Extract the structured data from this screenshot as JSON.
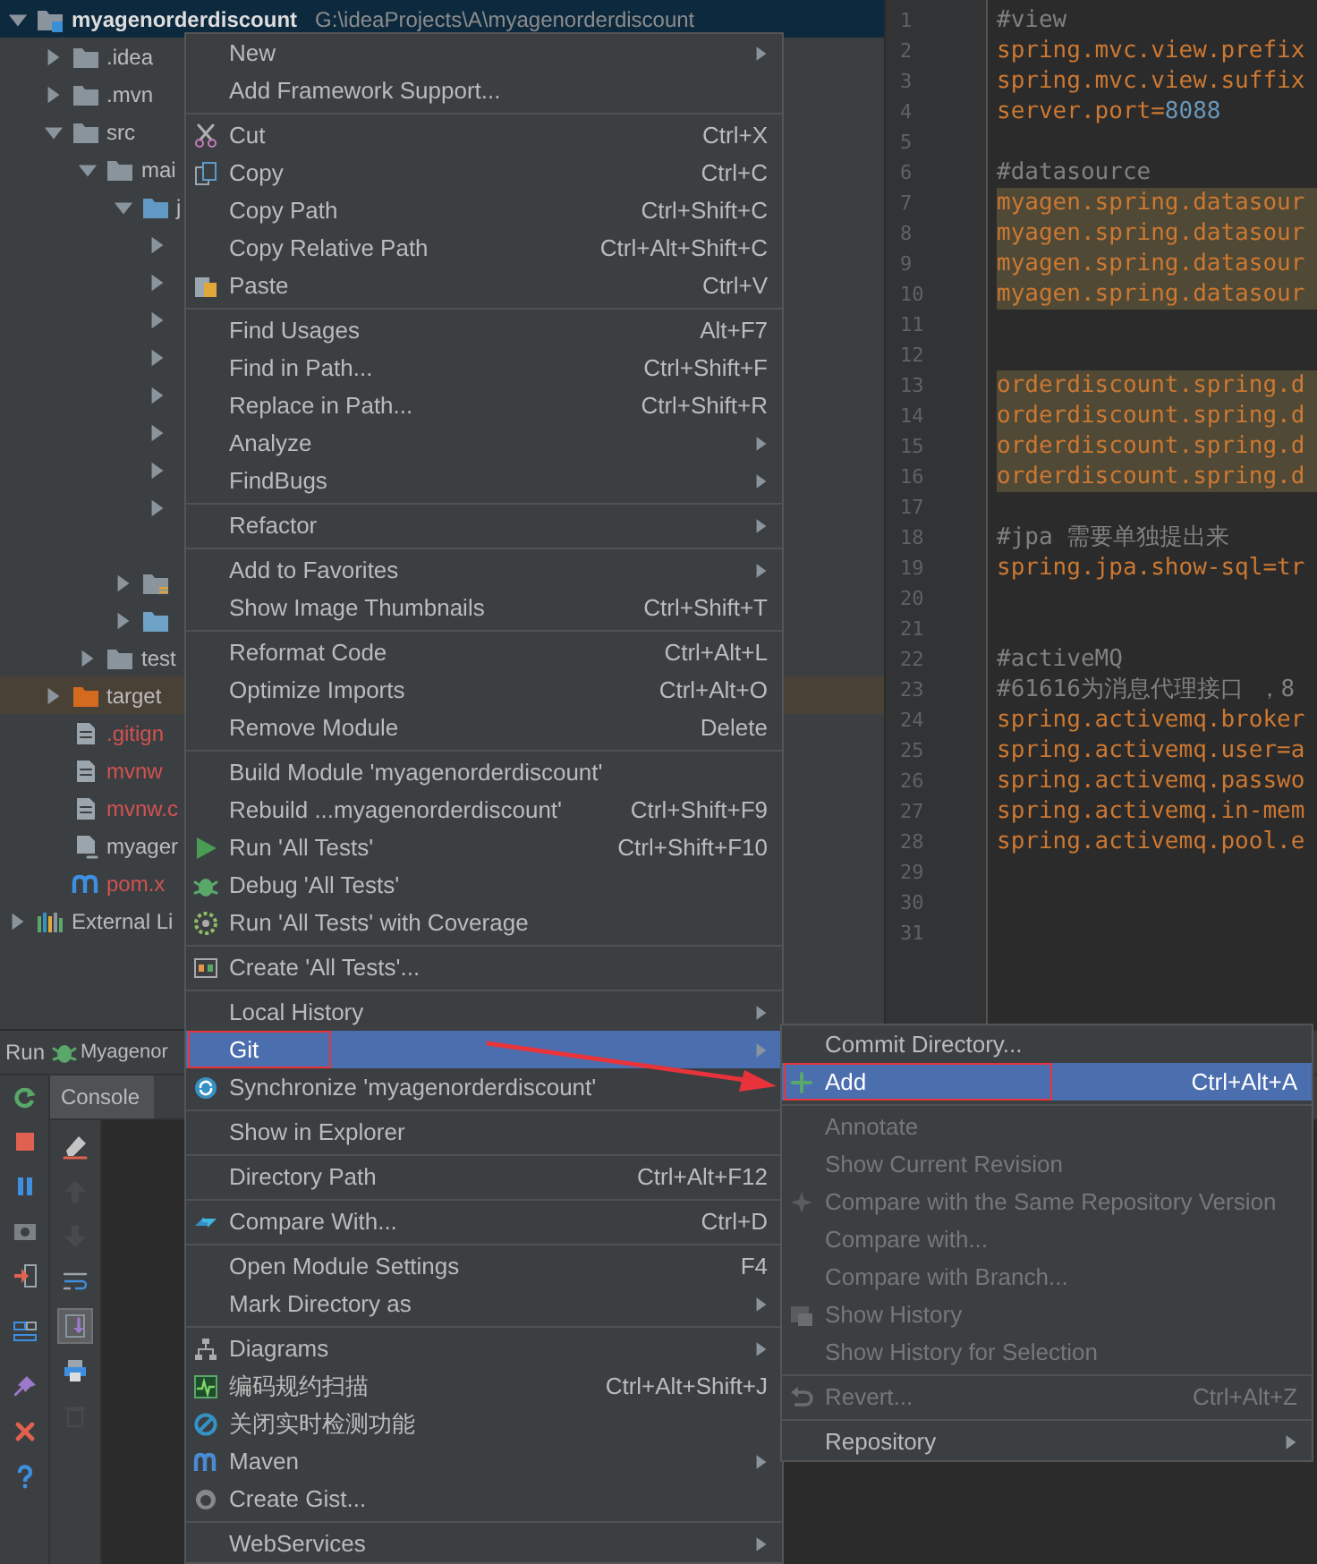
{
  "project_tree": [
    {
      "label": "myagenorderdiscount",
      "path": "G:\\ideaProjects\\A\\myagenorderdiscount",
      "kind": "module",
      "expanded": true,
      "selected": true,
      "untracked": false,
      "children": [
        {
          "label": ".idea",
          "kind": "folder",
          "expanded": false,
          "selected": false,
          "untracked": false
        },
        {
          "label": ".mvn",
          "kind": "folder",
          "expanded": false,
          "selected": false,
          "untracked": false
        },
        {
          "label": "src",
          "kind": "folder",
          "expanded": true,
          "selected": false,
          "untracked": false,
          "children": [
            {
              "label": "mai",
              "kind": "folder",
              "expanded": true,
              "selected": false,
              "untracked": false,
              "children": [
                {
                  "label": "j",
                  "kind": "source-folder",
                  "expanded": true,
                  "selected": false,
                  "untracked": false,
                  "children": [
                    {
                      "expanded": false,
                      "selected": false
                    },
                    {
                      "expanded": false,
                      "selected": false
                    },
                    {
                      "expanded": false,
                      "selected": false
                    },
                    {
                      "expanded": false,
                      "selected": false
                    },
                    {
                      "expanded": false,
                      "selected": false
                    },
                    {
                      "expanded": false,
                      "selected": false
                    },
                    {
                      "expanded": false,
                      "selected": false
                    },
                    {
                      "expanded": false,
                      "selected": false
                    },
                    {
                      "selected": false
                    }
                  ]
                },
                {
                  "kind": "resources-folder",
                  "expanded": false,
                  "selected": false
                },
                {
                  "kind": "web-folder",
                  "expanded": false,
                  "selected": false
                }
              ]
            },
            {
              "label": "test",
              "kind": "folder",
              "expanded": false,
              "selected": false,
              "untracked": false
            }
          ]
        },
        {
          "label": "target",
          "kind": "excluded-folder",
          "expanded": false,
          "selected": false,
          "untracked": false
        },
        {
          "label": ".gitign",
          "kind": "file",
          "selected": false,
          "untracked": true
        },
        {
          "label": "mvnw",
          "kind": "file",
          "selected": false,
          "untracked": true
        },
        {
          "label": "mvnw.c",
          "kind": "file",
          "selected": false,
          "untracked": true
        },
        {
          "label": "myager",
          "kind": "module-file",
          "selected": false,
          "untracked": false
        },
        {
          "label": "pom.x",
          "kind": "maven-file",
          "selected": false,
          "untracked": true
        }
      ]
    },
    {
      "label": "External Li",
      "kind": "library",
      "expanded": false,
      "selected": false,
      "untracked": false
    }
  ],
  "editor": {
    "lines": [
      {
        "n": "1",
        "kind": "comment",
        "text": "#view",
        "highlighted": false
      },
      {
        "n": "2",
        "kind": "property",
        "text": "spring.mvc.view.prefix",
        "highlighted": false
      },
      {
        "n": "3",
        "kind": "property",
        "text": "spring.mvc.view.suffix",
        "highlighted": false
      },
      {
        "n": "4",
        "kind": "property",
        "text": "server.port=",
        "value": "8088",
        "highlighted": false
      },
      {
        "n": "5",
        "kind": "blank",
        "highlighted": false
      },
      {
        "n": "6",
        "kind": "comment",
        "text": "#datasource",
        "highlighted": false
      },
      {
        "n": "7",
        "kind": "property",
        "text": "myagen.spring.datasour",
        "highlighted": true
      },
      {
        "n": "8",
        "kind": "property",
        "text": "myagen.spring.datasour",
        "highlighted": true
      },
      {
        "n": "9",
        "kind": "property",
        "text": "myagen.spring.datasour",
        "highlighted": true
      },
      {
        "n": "10",
        "kind": "property",
        "text": "myagen.spring.datasour",
        "highlighted": true
      },
      {
        "n": "11",
        "kind": "blank",
        "highlighted": false
      },
      {
        "n": "12",
        "kind": "blank",
        "highlighted": false
      },
      {
        "n": "13",
        "kind": "property",
        "text": "orderdiscount.spring.d",
        "highlighted": true
      },
      {
        "n": "14",
        "kind": "property",
        "text": "orderdiscount.spring.d",
        "highlighted": true
      },
      {
        "n": "15",
        "kind": "property",
        "text": "orderdiscount.spring.d",
        "highlighted": true
      },
      {
        "n": "16",
        "kind": "property",
        "text": "orderdiscount.spring.d",
        "highlighted": true
      },
      {
        "n": "17",
        "kind": "blank",
        "highlighted": false
      },
      {
        "n": "18",
        "kind": "comment",
        "text": "#jpa 需要单独提出来",
        "highlighted": false
      },
      {
        "n": "19",
        "kind": "property",
        "text": "spring.jpa.show-sql=tr",
        "highlighted": false
      },
      {
        "n": "20",
        "kind": "blank",
        "highlighted": false
      },
      {
        "n": "21",
        "kind": "blank",
        "highlighted": false
      },
      {
        "n": "22",
        "kind": "comment",
        "text": "#activeMQ",
        "highlighted": false
      },
      {
        "n": "23",
        "kind": "comment",
        "text": "#61616为消息代理接口 ，8",
        "highlighted": false
      },
      {
        "n": "24",
        "kind": "property",
        "text": "spring.activemq.broker",
        "highlighted": false
      },
      {
        "n": "25",
        "kind": "property",
        "text": "spring.activemq.user=a",
        "highlighted": false
      },
      {
        "n": "26",
        "kind": "property",
        "text": "spring.activemq.passwo",
        "highlighted": false
      },
      {
        "n": "27",
        "kind": "property",
        "text": "spring.activemq.in-mem",
        "highlighted": false
      },
      {
        "n": "28",
        "kind": "property",
        "text": "spring.activemq.pool.e",
        "highlighted": false
      },
      {
        "n": "29",
        "kind": "blank",
        "highlighted": false
      },
      {
        "n": "30",
        "kind": "blank",
        "highlighted": false
      },
      {
        "n": "31",
        "kind": "blank",
        "highlighted": false
      }
    ]
  },
  "run_panel": {
    "title": "Run",
    "config": "Myagenor",
    "tab": {
      "label": "Console",
      "selected": true
    },
    "console_tools": [
      {
        "disabled": false,
        "selected": false
      },
      {
        "disabled": true,
        "selected": false
      },
      {
        "disabled": true,
        "selected": false
      },
      {
        "disabled": false,
        "selected": false
      },
      {
        "disabled": false,
        "selected": true
      },
      {
        "disabled": false,
        "selected": false
      },
      {
        "disabled": true,
        "selected": false
      }
    ]
  },
  "context_menu": {
    "sections": [
      [
        {
          "label": "New",
          "has_submenu": true,
          "selected": false,
          "marked": false
        },
        {
          "label": "Add Framework Support...",
          "has_submenu": false,
          "selected": false,
          "marked": false
        }
      ],
      [
        {
          "label": "Cut",
          "shortcut": "Ctrl+X",
          "has_submenu": false,
          "selected": false,
          "marked": false
        },
        {
          "label": "Copy",
          "shortcut": "Ctrl+C",
          "has_submenu": false,
          "selected": false,
          "marked": false
        },
        {
          "label": "Copy Path",
          "shortcut": "Ctrl+Shift+C",
          "has_submenu": false,
          "selected": false,
          "marked": false
        },
        {
          "label": "Copy Relative Path",
          "shortcut": "Ctrl+Alt+Shift+C",
          "has_submenu": false,
          "selected": false,
          "marked": false
        },
        {
          "label": "Paste",
          "shortcut": "Ctrl+V",
          "has_submenu": false,
          "selected": false,
          "marked": false
        }
      ],
      [
        {
          "label": "Find Usages",
          "shortcut": "Alt+F7",
          "has_submenu": false,
          "selected": false,
          "marked": false
        },
        {
          "label": "Find in Path...",
          "shortcut": "Ctrl+Shift+F",
          "has_submenu": false,
          "selected": false,
          "marked": false
        },
        {
          "label": "Replace in Path...",
          "shortcut": "Ctrl+Shift+R",
          "has_submenu": false,
          "selected": false,
          "marked": false
        },
        {
          "label": "Analyze",
          "has_submenu": true,
          "selected": false,
          "marked": false
        },
        {
          "label": "FindBugs",
          "has_submenu": true,
          "selected": false,
          "marked": false
        }
      ],
      [
        {
          "label": "Refactor",
          "has_submenu": true,
          "selected": false,
          "marked": false
        }
      ],
      [
        {
          "label": "Add to Favorites",
          "has_submenu": true,
          "selected": false,
          "marked": false
        },
        {
          "label": "Show Image Thumbnails",
          "shortcut": "Ctrl+Shift+T",
          "has_submenu": false,
          "selected": false,
          "marked": false
        }
      ],
      [
        {
          "label": "Reformat Code",
          "shortcut": "Ctrl+Alt+L",
          "has_submenu": false,
          "selected": false,
          "marked": false
        },
        {
          "label": "Optimize Imports",
          "shortcut": "Ctrl+Alt+O",
          "has_submenu": false,
          "selected": false,
          "marked": false
        },
        {
          "label": "Remove Module",
          "shortcut": "Delete",
          "has_submenu": false,
          "selected": false,
          "marked": false
        }
      ],
      [
        {
          "label": "Build Module 'myagenorderdiscount'",
          "has_submenu": false,
          "selected": false,
          "marked": false
        },
        {
          "label": "Rebuild ...myagenorderdiscount'",
          "shortcut": "Ctrl+Shift+F9",
          "has_submenu": false,
          "selected": false,
          "marked": false
        },
        {
          "label": "Run 'All Tests'",
          "shortcut": "Ctrl+Shift+F10",
          "has_submenu": false,
          "selected": false,
          "marked": false
        },
        {
          "label": "Debug 'All Tests'",
          "has_submenu": false,
          "selected": false,
          "marked": false
        },
        {
          "label": "Run 'All Tests' with Coverage",
          "has_submenu": false,
          "selected": false,
          "marked": false
        }
      ],
      [
        {
          "label": "Create 'All Tests'...",
          "has_submenu": false,
          "selected": false,
          "marked": false
        }
      ],
      [
        {
          "label": "Local History",
          "has_submenu": true,
          "selected": false,
          "marked": false
        },
        {
          "label": "Git",
          "has_submenu": true,
          "selected": true,
          "marked": true
        },
        {
          "label": "Synchronize 'myagenorderdiscount'",
          "has_submenu": false,
          "selected": false,
          "marked": false
        }
      ],
      [
        {
          "label": "Show in Explorer",
          "has_submenu": false,
          "selected": false,
          "marked": false
        }
      ],
      [
        {
          "label": "Directory Path",
          "shortcut": "Ctrl+Alt+F12",
          "has_submenu": false,
          "selected": false,
          "marked": false
        }
      ],
      [
        {
          "label": "Compare With...",
          "shortcut": "Ctrl+D",
          "has_submenu": false,
          "selected": false,
          "marked": false
        }
      ],
      [
        {
          "label": "Open Module Settings",
          "shortcut": "F4",
          "has_submenu": false,
          "selected": false,
          "marked": false
        },
        {
          "label": "Mark Directory as",
          "has_submenu": true,
          "selected": false,
          "marked": false
        }
      ],
      [
        {
          "label": "Diagrams",
          "has_submenu": true,
          "selected": false,
          "marked": false
        },
        {
          "label": "编码规约扫描",
          "shortcut": "Ctrl+Alt+Shift+J",
          "has_submenu": false,
          "selected": false,
          "marked": false
        },
        {
          "label": "关闭实时检测功能",
          "has_submenu": false,
          "selected": false,
          "marked": false
        },
        {
          "label": "Maven",
          "has_submenu": true,
          "selected": false,
          "marked": false
        },
        {
          "label": "Create Gist...",
          "has_submenu": false,
          "selected": false,
          "marked": false
        }
      ],
      [
        {
          "label": "WebServices",
          "has_submenu": true,
          "selected": false,
          "marked": false
        }
      ]
    ]
  },
  "git_submenu": {
    "sections": [
      [
        {
          "label": "Commit Directory...",
          "has_submenu": false,
          "selected": false,
          "marked": false,
          "disabled": false
        },
        {
          "label": "Add",
          "shortcut": "Ctrl+Alt+A",
          "has_submenu": false,
          "selected": true,
          "marked": true,
          "disabled": false
        }
      ],
      [
        {
          "label": "Annotate",
          "has_submenu": false,
          "selected": false,
          "marked": false,
          "disabled": true
        },
        {
          "label": "Show Current Revision",
          "has_submenu": false,
          "selected": false,
          "marked": false,
          "disabled": true
        },
        {
          "label": "Compare with the Same Repository Version",
          "has_submenu": false,
          "selected": false,
          "marked": false,
          "disabled": true
        },
        {
          "label": "Compare with...",
          "has_submenu": false,
          "selected": false,
          "marked": false,
          "disabled": true
        },
        {
          "label": "Compare with Branch...",
          "has_submenu": false,
          "selected": false,
          "marked": false,
          "disabled": true
        },
        {
          "label": "Show History",
          "has_submenu": false,
          "selected": false,
          "marked": false,
          "disabled": true
        },
        {
          "label": "Show History for Selection",
          "has_submenu": false,
          "selected": false,
          "marked": false,
          "disabled": true
        }
      ],
      [
        {
          "label": "Revert...",
          "shortcut": "Ctrl+Alt+Z",
          "has_submenu": false,
          "selected": false,
          "marked": false,
          "disabled": true
        }
      ],
      [
        {
          "label": "Repository",
          "has_submenu": true,
          "selected": false,
          "marked": false,
          "disabled": false
        }
      ]
    ]
  }
}
